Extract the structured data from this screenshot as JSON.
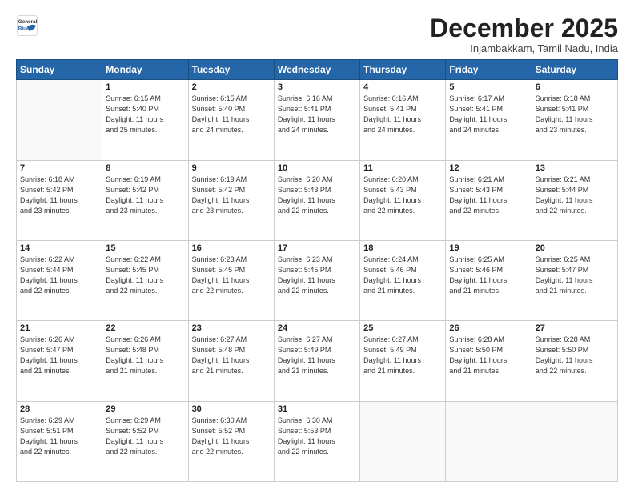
{
  "logo": {
    "line1": "General",
    "line2": "Blue"
  },
  "header": {
    "month": "December 2025",
    "location": "Injambakkam, Tamil Nadu, India"
  },
  "weekdays": [
    "Sunday",
    "Monday",
    "Tuesday",
    "Wednesday",
    "Thursday",
    "Friday",
    "Saturday"
  ],
  "weeks": [
    [
      {
        "day": "",
        "info": ""
      },
      {
        "day": "1",
        "info": "Sunrise: 6:15 AM\nSunset: 5:40 PM\nDaylight: 11 hours\nand 25 minutes."
      },
      {
        "day": "2",
        "info": "Sunrise: 6:15 AM\nSunset: 5:40 PM\nDaylight: 11 hours\nand 24 minutes."
      },
      {
        "day": "3",
        "info": "Sunrise: 6:16 AM\nSunset: 5:41 PM\nDaylight: 11 hours\nand 24 minutes."
      },
      {
        "day": "4",
        "info": "Sunrise: 6:16 AM\nSunset: 5:41 PM\nDaylight: 11 hours\nand 24 minutes."
      },
      {
        "day": "5",
        "info": "Sunrise: 6:17 AM\nSunset: 5:41 PM\nDaylight: 11 hours\nand 24 minutes."
      },
      {
        "day": "6",
        "info": "Sunrise: 6:18 AM\nSunset: 5:41 PM\nDaylight: 11 hours\nand 23 minutes."
      }
    ],
    [
      {
        "day": "7",
        "info": "Sunrise: 6:18 AM\nSunset: 5:42 PM\nDaylight: 11 hours\nand 23 minutes."
      },
      {
        "day": "8",
        "info": "Sunrise: 6:19 AM\nSunset: 5:42 PM\nDaylight: 11 hours\nand 23 minutes."
      },
      {
        "day": "9",
        "info": "Sunrise: 6:19 AM\nSunset: 5:42 PM\nDaylight: 11 hours\nand 23 minutes."
      },
      {
        "day": "10",
        "info": "Sunrise: 6:20 AM\nSunset: 5:43 PM\nDaylight: 11 hours\nand 22 minutes."
      },
      {
        "day": "11",
        "info": "Sunrise: 6:20 AM\nSunset: 5:43 PM\nDaylight: 11 hours\nand 22 minutes."
      },
      {
        "day": "12",
        "info": "Sunrise: 6:21 AM\nSunset: 5:43 PM\nDaylight: 11 hours\nand 22 minutes."
      },
      {
        "day": "13",
        "info": "Sunrise: 6:21 AM\nSunset: 5:44 PM\nDaylight: 11 hours\nand 22 minutes."
      }
    ],
    [
      {
        "day": "14",
        "info": "Sunrise: 6:22 AM\nSunset: 5:44 PM\nDaylight: 11 hours\nand 22 minutes."
      },
      {
        "day": "15",
        "info": "Sunrise: 6:22 AM\nSunset: 5:45 PM\nDaylight: 11 hours\nand 22 minutes."
      },
      {
        "day": "16",
        "info": "Sunrise: 6:23 AM\nSunset: 5:45 PM\nDaylight: 11 hours\nand 22 minutes."
      },
      {
        "day": "17",
        "info": "Sunrise: 6:23 AM\nSunset: 5:45 PM\nDaylight: 11 hours\nand 22 minutes."
      },
      {
        "day": "18",
        "info": "Sunrise: 6:24 AM\nSunset: 5:46 PM\nDaylight: 11 hours\nand 21 minutes."
      },
      {
        "day": "19",
        "info": "Sunrise: 6:25 AM\nSunset: 5:46 PM\nDaylight: 11 hours\nand 21 minutes."
      },
      {
        "day": "20",
        "info": "Sunrise: 6:25 AM\nSunset: 5:47 PM\nDaylight: 11 hours\nand 21 minutes."
      }
    ],
    [
      {
        "day": "21",
        "info": "Sunrise: 6:26 AM\nSunset: 5:47 PM\nDaylight: 11 hours\nand 21 minutes."
      },
      {
        "day": "22",
        "info": "Sunrise: 6:26 AM\nSunset: 5:48 PM\nDaylight: 11 hours\nand 21 minutes."
      },
      {
        "day": "23",
        "info": "Sunrise: 6:27 AM\nSunset: 5:48 PM\nDaylight: 11 hours\nand 21 minutes."
      },
      {
        "day": "24",
        "info": "Sunrise: 6:27 AM\nSunset: 5:49 PM\nDaylight: 11 hours\nand 21 minutes."
      },
      {
        "day": "25",
        "info": "Sunrise: 6:27 AM\nSunset: 5:49 PM\nDaylight: 11 hours\nand 21 minutes."
      },
      {
        "day": "26",
        "info": "Sunrise: 6:28 AM\nSunset: 5:50 PM\nDaylight: 11 hours\nand 21 minutes."
      },
      {
        "day": "27",
        "info": "Sunrise: 6:28 AM\nSunset: 5:50 PM\nDaylight: 11 hours\nand 22 minutes."
      }
    ],
    [
      {
        "day": "28",
        "info": "Sunrise: 6:29 AM\nSunset: 5:51 PM\nDaylight: 11 hours\nand 22 minutes."
      },
      {
        "day": "29",
        "info": "Sunrise: 6:29 AM\nSunset: 5:52 PM\nDaylight: 11 hours\nand 22 minutes."
      },
      {
        "day": "30",
        "info": "Sunrise: 6:30 AM\nSunset: 5:52 PM\nDaylight: 11 hours\nand 22 minutes."
      },
      {
        "day": "31",
        "info": "Sunrise: 6:30 AM\nSunset: 5:53 PM\nDaylight: 11 hours\nand 22 minutes."
      },
      {
        "day": "",
        "info": ""
      },
      {
        "day": "",
        "info": ""
      },
      {
        "day": "",
        "info": ""
      }
    ]
  ]
}
